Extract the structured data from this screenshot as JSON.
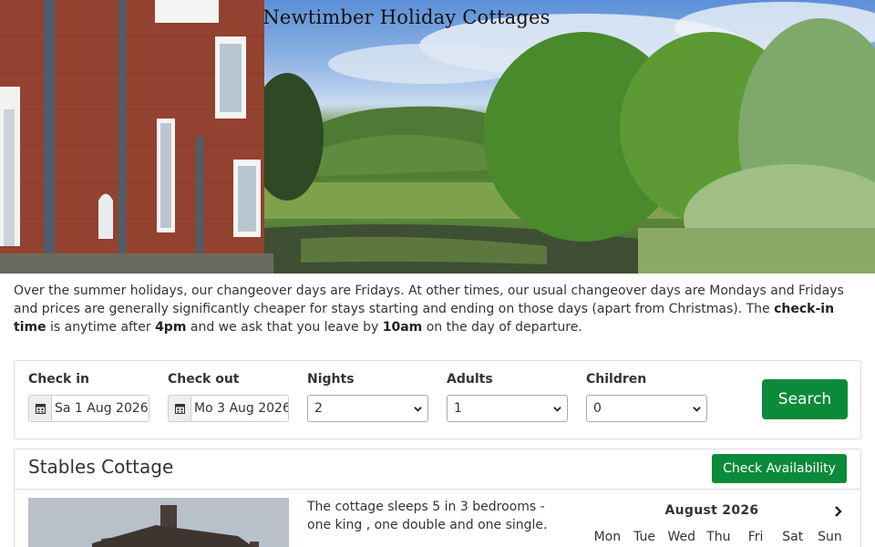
{
  "site": {
    "title": "Newtimber Holiday Cottages"
  },
  "intro": {
    "text1": "Over the summer holidays, our changeover days are Fridays. At other times, our usual changeover days are Mondays and Fridays and prices are generally significantly cheaper for stays starting and ending on those days (apart from Christmas). The ",
    "bold1": "check-in time",
    "text2": " is anytime after ",
    "bold2": "4pm",
    "text3": " and we ask that you leave by ",
    "bold3": "10am",
    "text4": " on the day of departure."
  },
  "search": {
    "checkin_label": "Check in",
    "checkin_value": "Sa 1 Aug 2026",
    "checkout_label": "Check out",
    "checkout_value": "Mo 3 Aug 2026",
    "nights_label": "Nights",
    "nights_value": "2",
    "adults_label": "Adults",
    "adults_value": "1",
    "children_label": "Children",
    "children_value": "0",
    "search_button": "Search"
  },
  "cottage": {
    "name": "Stables Cottage",
    "check_button": "Check Availability",
    "description": "The cottage sleeps 5 in 3 bedrooms - one king , one double and one single.",
    "calendar": {
      "month": "August 2026",
      "weekdays": [
        "Mon",
        "Tue",
        "Wed",
        "Thu",
        "Fri",
        "Sat",
        "Sun"
      ]
    }
  },
  "icons": {
    "calendar": "calendar-icon",
    "chevron_down": "chevron-down-icon",
    "chevron_right": "chevron-right-icon"
  },
  "colors": {
    "accent": "#0b8a3a",
    "border": "#dddddd"
  }
}
